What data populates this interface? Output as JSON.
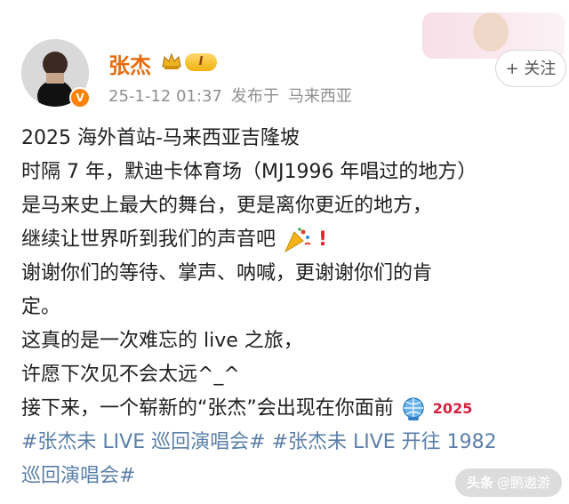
{
  "post": {
    "author": "张杰",
    "level": "I",
    "time": "25-1-12 01:37",
    "location_prefix": "发布于",
    "location": "马来西亚",
    "follow_label": "+ 关注",
    "lines": [
      "2025 海外首站-马来西亚吉隆坡",
      "时隔 7 年，默迪卡体育场（MJ1996 年唱过的地方）",
      "是马来史上最大的舞台，更是离你更近的地方，",
      "继续让世界听到我们的声音吧",
      "谢谢你们的等待、掌声、呐喊，更谢谢你们的肯",
      "定。",
      "这真的是一次难忘的 live 之旅，",
      "许愿下次见不会太远^_^",
      "接下来，一个崭新的“张杰”会出现在你面前"
    ],
    "topic_1": "#张杰未 LIVE 巡回演唱会#",
    "topic_2_part1": "#张杰未 LIVE 开往 1982",
    "topic_2_part2": "巡回演唱会#",
    "badge_2025": "2025",
    "exclaim": "!"
  },
  "watermark": {
    "brand": "头条",
    "handle": "@鹏遨游"
  },
  "colors": {
    "author": "#e86b0b",
    "topic": "#5b7fa8",
    "meta": "#8f8f8f"
  },
  "icons": {
    "crown": "crown-icon",
    "party": "party-popper-icon",
    "exclaim": "red-exclamation-icon",
    "globe": "globe-icon"
  }
}
